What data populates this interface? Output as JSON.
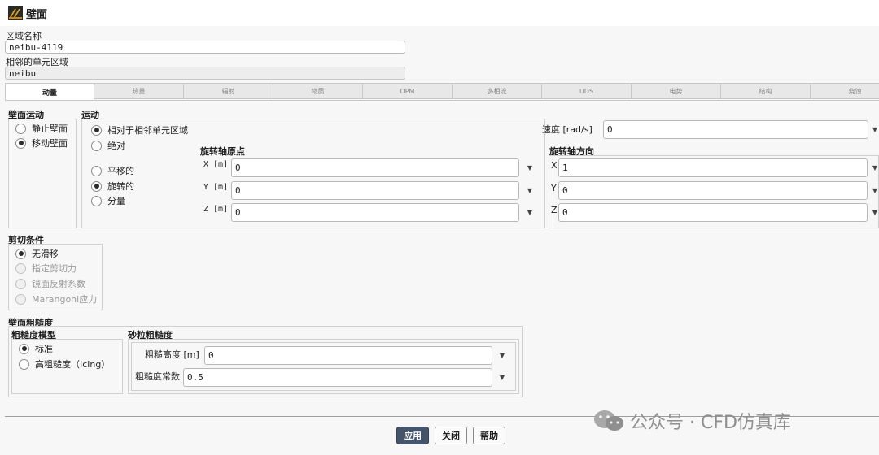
{
  "window": {
    "title": "壁面",
    "icon": "wall-boundary-icon"
  },
  "zone": {
    "name_label": "区域名称",
    "name_value": "neibu-4119",
    "adjacent_label": "相邻的单元区域",
    "adjacent_value": "neibu"
  },
  "tabs": [
    "动量",
    "热量",
    "辐射",
    "物质",
    "DPM",
    "多相流",
    "UDS",
    "电势",
    "结构",
    "烧蚀"
  ],
  "wall_motion": {
    "title": "壁面运动",
    "options": [
      {
        "label": "静止壁面",
        "selected": false
      },
      {
        "label": "移动壁面",
        "selected": true
      }
    ]
  },
  "motion": {
    "title": "运动",
    "reference_options": [
      {
        "label": "相对于相邻单元区域",
        "selected": true
      },
      {
        "label": "绝对",
        "selected": false
      }
    ],
    "type_options": [
      {
        "label": "平移的",
        "selected": false
      },
      {
        "label": "旋转的",
        "selected": true
      },
      {
        "label": "分量",
        "selected": false
      }
    ],
    "speed_label": "速度 [rad/s]",
    "speed_value": "0",
    "origin": {
      "title": "旋转轴原点",
      "x_label": "X [m]",
      "x_value": "0",
      "y_label": "Y [m]",
      "y_value": "0",
      "z_label": "Z [m]",
      "z_value": "0"
    },
    "direction": {
      "title": "旋转轴方向",
      "x_label": "X",
      "x_value": "1",
      "y_label": "Y",
      "y_value": "0",
      "z_label": "Z",
      "z_value": "0"
    }
  },
  "shear": {
    "title": "剪切条件",
    "options": [
      {
        "label": "无滑移",
        "selected": true,
        "enabled": true
      },
      {
        "label": "指定剪切力",
        "selected": false,
        "enabled": false
      },
      {
        "label": "镜面反射系数",
        "selected": false,
        "enabled": false
      },
      {
        "label": "Marangoni应力",
        "selected": false,
        "enabled": false
      }
    ]
  },
  "roughness": {
    "title": "壁面粗糙度",
    "model_title": "粗糙度模型",
    "model_options": [
      {
        "label": "标准",
        "selected": true
      },
      {
        "label": "高粗糙度（Icing）",
        "selected": false
      }
    ],
    "sand_title": "砂粒粗糙度",
    "height_label": "粗糙高度 [m]",
    "height_value": "0",
    "constant_label": "粗糙度常数",
    "constant_value": "0.5"
  },
  "buttons": {
    "apply": "应用",
    "close": "关闭",
    "help": "帮助"
  },
  "watermark": {
    "text": "公众号 · CFD仿真库",
    "icon": "wechat-icon"
  },
  "colors": {
    "primary_button": "#44546a"
  }
}
